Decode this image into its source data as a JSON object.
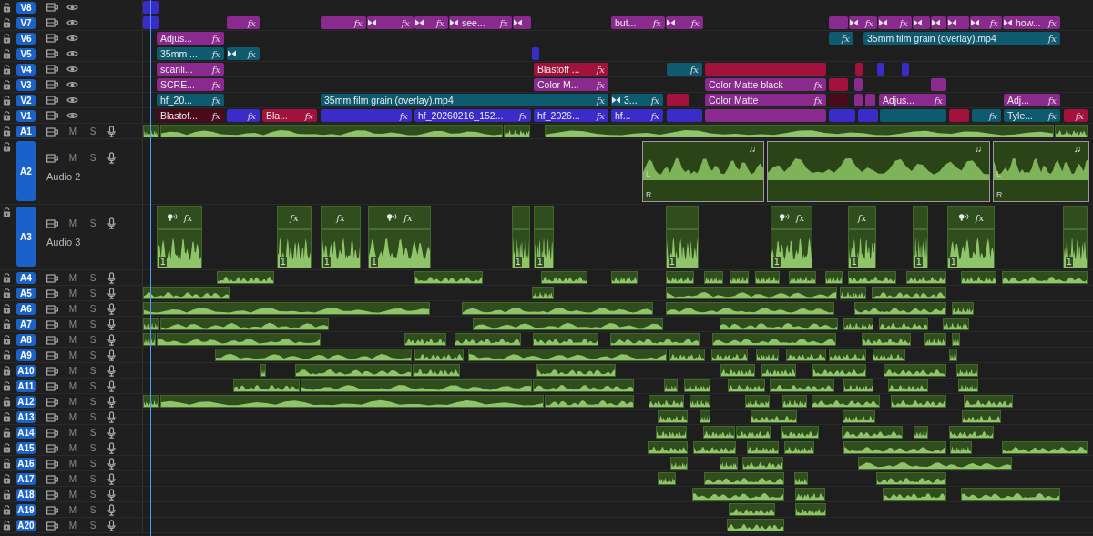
{
  "video_tracks": [
    {
      "label": "V8",
      "clips": [
        {
          "color": "#3a2cc8"
        }
      ]
    },
    {
      "label": "V7",
      "clips": [
        {
          "color": "#3a2cc8"
        },
        {
          "color": "#8a2a8e",
          "fx": "fx"
        },
        {
          "color": "#8a2a8e",
          "fx": "fx"
        },
        {
          "color": "#8a2a8e",
          "fx": "fx",
          "transition": true
        },
        {
          "color": "#8a2a8e",
          "fx": "fx",
          "transition": true
        },
        {
          "color": "#8a2a8e",
          "label": "see...",
          "fx": "fx",
          "transition": true
        },
        {
          "color": "#8a2a8e",
          "transition": true
        },
        {
          "color": "#8a2a8e",
          "label": "but...",
          "fx": "fx"
        },
        {
          "color": "#8a2a8e",
          "fx": "fx",
          "transition": true
        },
        {
          "color": "#8a2a8e"
        },
        {
          "color": "#8a2a8e",
          "fx": "fx",
          "transition": true
        },
        {
          "color": "#8a2a8e",
          "fx": "fx",
          "transition": true
        },
        {
          "color": "#8a2a8e",
          "transition": true
        },
        {
          "color": "#8a2a8e",
          "transition": true
        },
        {
          "color": "#8a2a8e",
          "transition": true
        },
        {
          "color": "#8a2a8e",
          "fx": "fx",
          "transition": true
        },
        {
          "color": "#8a2a8e",
          "label": "how...",
          "fx": "fx",
          "transition": true
        }
      ]
    },
    {
      "label": "V6",
      "clips": [
        {
          "color": "#8a2a8e",
          "label": "Adjus...",
          "fx": "fx"
        },
        {
          "color": "#0e5a6e",
          "fx": "fx"
        },
        {
          "color": "#0e5a6e",
          "label": "35mm film grain (overlay).mp4",
          "fx": "fx"
        }
      ]
    },
    {
      "label": "V5",
      "clips": [
        {
          "color": "#0e5a6e",
          "label": "35mm ...",
          "fx": "fx"
        },
        {
          "color": "#0e5a6e",
          "fx": "fx",
          "transition": true
        },
        {
          "color": "#3a2cc8"
        }
      ]
    },
    {
      "label": "V4",
      "clips": [
        {
          "color": "#8a2a8e",
          "label": "scanli...",
          "fx": "fx"
        },
        {
          "color": "#a3123c",
          "label": "Blastoff ...",
          "fx": "fx"
        },
        {
          "color": "#0e5a6e",
          "fx": "fx"
        },
        {
          "color": "#a3123c"
        },
        {
          "color": "#a3123c"
        },
        {
          "color": "#3a2cc8"
        },
        {
          "color": "#3a2cc8"
        }
      ]
    },
    {
      "label": "V3",
      "clips": [
        {
          "color": "#8a2a8e",
          "label": "SCRE...",
          "fx": "fx"
        },
        {
          "color": "#8a2a8e",
          "label": "Color M...",
          "fx": "fx"
        },
        {
          "color": "#8a2a8e",
          "label": "Color Matte black",
          "fx": "fx"
        },
        {
          "color": "#a3123c"
        },
        {
          "color": "#8a2a8e"
        },
        {
          "color": "#8a2a8e"
        }
      ]
    },
    {
      "label": "V2",
      "clips": [
        {
          "color": "#0e5a6e",
          "label": "hf_20...",
          "fx": "fx"
        },
        {
          "color": "#0e5a6e",
          "label": "35mm film grain (overlay).mp4",
          "fx": "fx"
        },
        {
          "color": "#0e5a6e",
          "label": "3...",
          "fx": "fx",
          "transition": true
        },
        {
          "color": "#a3123c"
        },
        {
          "color": "#8a2a8e",
          "label": "Color Matte",
          "fx": "fx"
        },
        {
          "color": "#4a0a1c"
        },
        {
          "color": "#8a2a8e"
        },
        {
          "color": "#8a2a8e"
        },
        {
          "color": "#8a2a8e",
          "label": "Adjus...",
          "fx": "fx"
        },
        {
          "color": "#8a2a8e",
          "label": "Adj...",
          "fx": "fx"
        }
      ]
    },
    {
      "label": "V1",
      "clips": [
        {
          "color": "#4a0a1c",
          "label": "Blastof...",
          "fx": "fx"
        },
        {
          "color": "#3a2cc8",
          "fx": "fx"
        },
        {
          "color": "#a3123c",
          "label": "Bla...",
          "fx": "fx"
        },
        {
          "color": "#3a2cc8",
          "fx": "fx"
        },
        {
          "color": "#3a2cc8",
          "label": "hf_20260216_152...",
          "fx": "fx"
        },
        {
          "color": "#3a2cc8",
          "label": "hf_2026...",
          "fx": "fx"
        },
        {
          "color": "#3a2cc8",
          "label": "hf...",
          "fx": "fx"
        },
        {
          "color": "#3a2cc8"
        },
        {
          "color": "#8a2a8e"
        },
        {
          "color": "#3a2cc8"
        },
        {
          "color": "#3a2cc8"
        },
        {
          "color": "#0e5a6e"
        },
        {
          "color": "#a3123c"
        },
        {
          "color": "#0e5a6e",
          "fx": "fx"
        },
        {
          "color": "#0e5a6e",
          "label": "Tyle...",
          "fx": "fx"
        },
        {
          "color": "#a3123c",
          "fx": "fx"
        }
      ]
    }
  ],
  "audio_tracks": [
    {
      "label": "A1",
      "mute": "M",
      "solo": "S"
    },
    {
      "label": "A2",
      "mute": "M",
      "solo": "S",
      "name": "Audio 2",
      "segments": [
        {
          "note": "♫",
          "left": "L",
          "right": "R"
        },
        {
          "note": "♫"
        },
        {
          "note": "♫",
          "left": "L",
          "right": "R"
        }
      ]
    },
    {
      "label": "A3",
      "mute": "M",
      "solo": "S",
      "name": "Audio 3",
      "clips": [
        {
          "speaker": true,
          "fx": "fx",
          "channel": "1"
        },
        {
          "speaker": false,
          "fx": "fx",
          "channel": "1"
        },
        {
          "speaker": false,
          "fx": "fx",
          "channel": "1"
        },
        {
          "speaker": true,
          "fx": "fx",
          "channel": "1"
        },
        {
          "speaker": false,
          "channel": "1"
        },
        {
          "speaker": false,
          "channel": "1"
        },
        {
          "speaker": false,
          "channel": "1"
        },
        {
          "speaker": true,
          "fx": "fx",
          "channel": "1"
        },
        {
          "speaker": false,
          "fx": "fx",
          "channel": "1"
        },
        {
          "speaker": false,
          "channel": "1"
        },
        {
          "speaker": true,
          "fx": "fx",
          "channel": "1"
        },
        {
          "speaker": false,
          "channel": "1"
        }
      ]
    },
    {
      "label": "A4",
      "mute": "M",
      "solo": "S"
    },
    {
      "label": "A5",
      "mute": "M",
      "solo": "S"
    },
    {
      "label": "A6",
      "mute": "M",
      "solo": "S"
    },
    {
      "label": "A7",
      "mute": "M",
      "solo": "S"
    },
    {
      "label": "A8",
      "mute": "M",
      "solo": "S"
    },
    {
      "label": "A9",
      "mute": "M",
      "solo": "S"
    },
    {
      "label": "A10",
      "mute": "M",
      "solo": "S"
    },
    {
      "label": "A11",
      "mute": "M",
      "solo": "S"
    },
    {
      "label": "A12",
      "mute": "M",
      "solo": "S"
    },
    {
      "label": "A13",
      "mute": "M",
      "solo": "S"
    },
    {
      "label": "A14",
      "mute": "M",
      "solo": "S"
    },
    {
      "label": "A15",
      "mute": "M",
      "solo": "S"
    },
    {
      "label": "A16",
      "mute": "M",
      "solo": "S"
    },
    {
      "label": "A17",
      "mute": "M",
      "solo": "S"
    },
    {
      "label": "A18",
      "mute": "M",
      "solo": "S"
    },
    {
      "label": "A19",
      "mute": "M",
      "solo": "S"
    },
    {
      "label": "A20",
      "mute": "M",
      "solo": "S"
    }
  ]
}
